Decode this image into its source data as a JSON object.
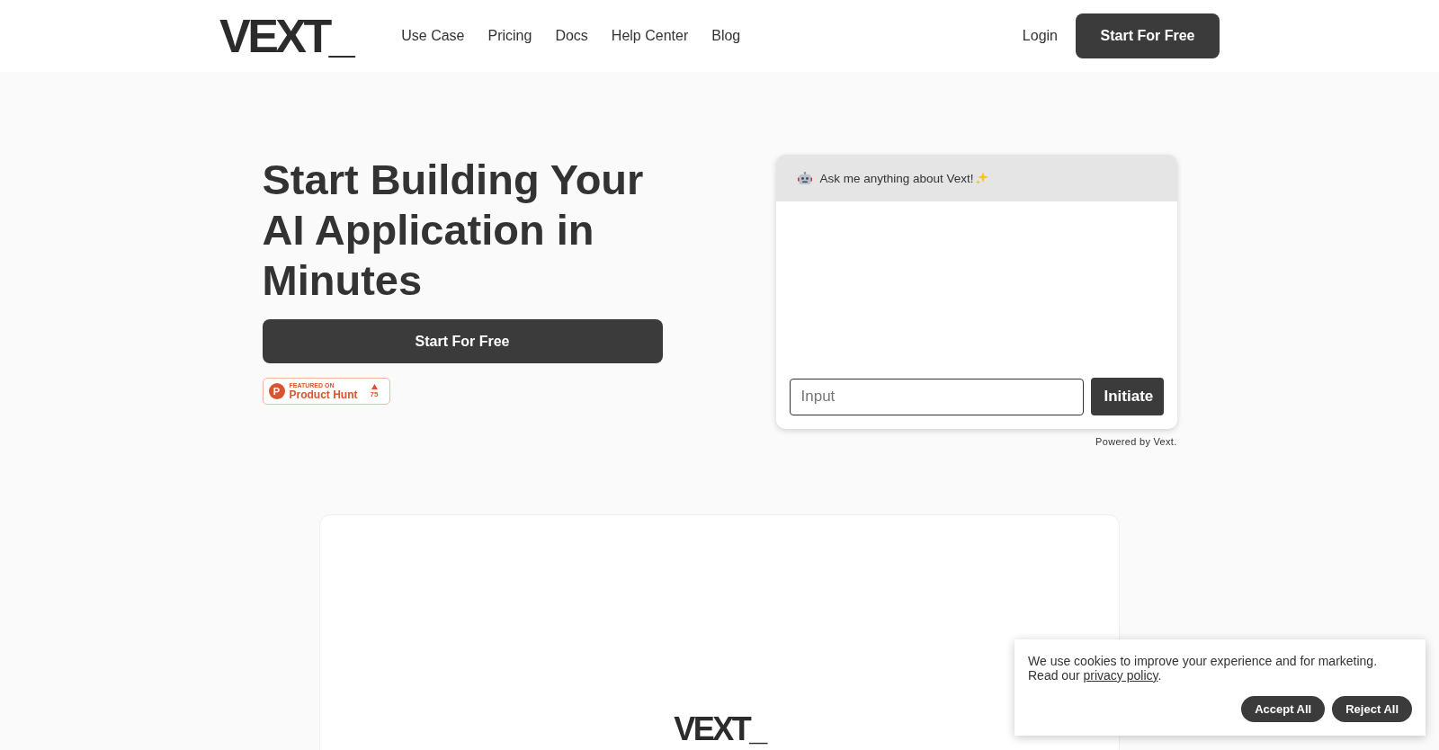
{
  "header": {
    "logo": "VEXT_",
    "nav": [
      "Use Case",
      "Pricing",
      "Docs",
      "Help Center",
      "Blog"
    ],
    "login": "Login",
    "cta": "Start For Free"
  },
  "hero": {
    "title": "Start Building Your AI Application in Minutes",
    "cta": "Start For Free",
    "badge": {
      "logo_letter": "P",
      "eyebrow": "FEATURED ON",
      "name": "Product Hunt",
      "votes": "75"
    }
  },
  "chat": {
    "greeting": "Ask me anything about Vext!",
    "input": {
      "placeholder": "Input"
    },
    "submit": "Initiate",
    "footer": "Powered by Vext."
  },
  "preview": {
    "logo": "VEXT_"
  },
  "cookie_banner": {
    "text": "We use cookies to improve your experience and for marketing.",
    "text_2": "Read our",
    "link": "privacy policy",
    "text_end": ".",
    "buttons": [
      "Accept All",
      "Reject All"
    ]
  }
}
